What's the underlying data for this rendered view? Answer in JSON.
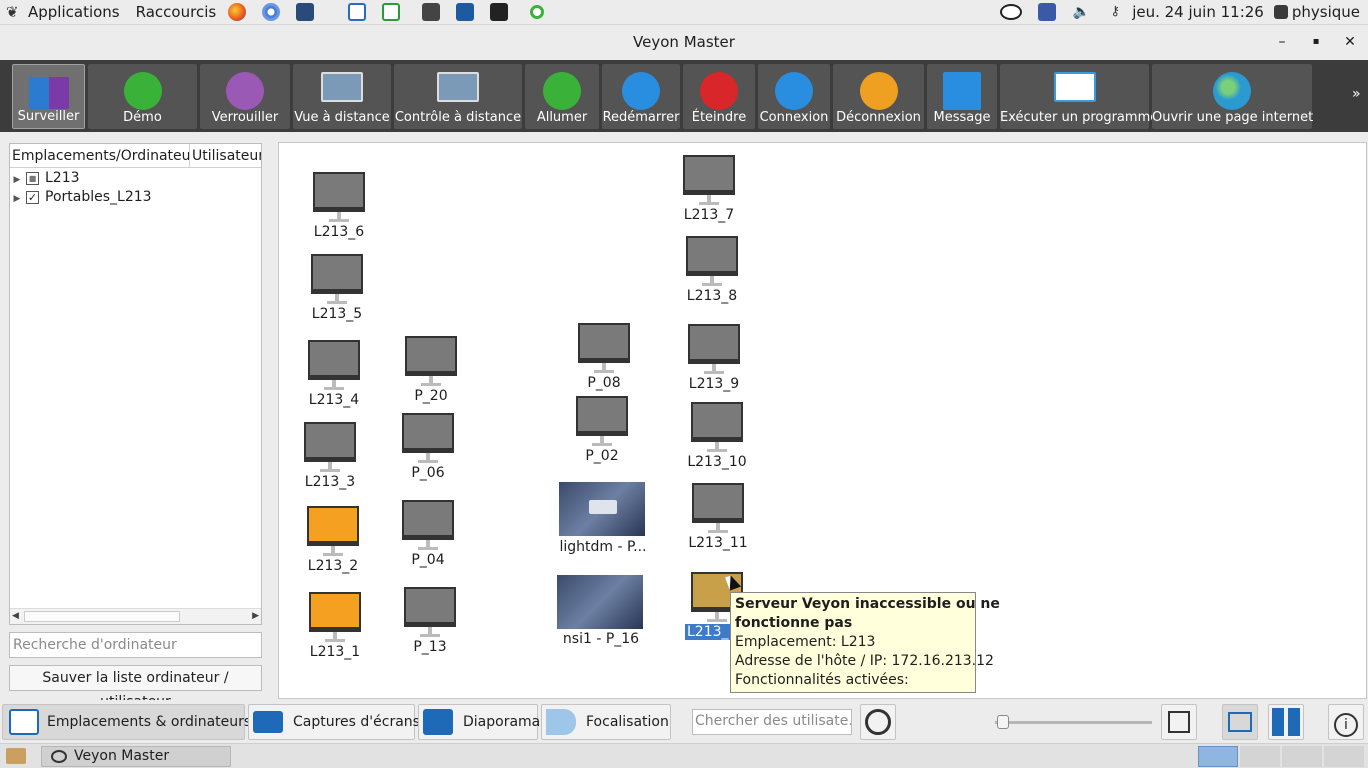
{
  "panel": {
    "applications": "Applications",
    "shortcuts": "Raccourcis",
    "clock": "jeu. 24 juin 11:26",
    "user": "physique",
    "launchers": [
      "firefox-icon",
      "chromium-icon",
      "files-icon",
      "writer-icon",
      "calc-icon",
      "scanner-icon",
      "virtualbox-icon",
      "terminal-icon",
      "sync-icon"
    ]
  },
  "window": {
    "title": "Veyon Master",
    "minimize": "–",
    "maximize": "▪",
    "close": "✕"
  },
  "toolbar": {
    "items": [
      {
        "label": "Surveiller",
        "color": "#3a7ad0"
      },
      {
        "label": "Démo",
        "color": "#3ab23a"
      },
      {
        "label": "Verrouiller",
        "color": "#9b59b6"
      },
      {
        "label": "Vue à distance",
        "color": "#7a9ab8"
      },
      {
        "label": "Contrôle à distance",
        "color": "#7a9ab8"
      },
      {
        "label": "Allumer",
        "color": "#3ab23a"
      },
      {
        "label": "Redémarrer",
        "color": "#2a8ee0"
      },
      {
        "label": "Éteindre",
        "color": "#d9262a"
      },
      {
        "label": "Connexion",
        "color": "#2a8ee0"
      },
      {
        "label": "Déconnexion",
        "color": "#f0a020"
      },
      {
        "label": "Message",
        "color": "#2a8ee0"
      },
      {
        "label": "Exécuter un programme",
        "color": "#3a9ae0"
      },
      {
        "label": "Ouvrir une page internet",
        "color": "#2a9ad0"
      }
    ],
    "more": "»"
  },
  "tree": {
    "col1": "Emplacements/Ordinateur",
    "col2": "Utilisateur",
    "rows": [
      {
        "label": "L213",
        "check": "■"
      },
      {
        "label": "Portables_L213",
        "check": "✓"
      }
    ]
  },
  "search_computer": {
    "placeholder": "Recherche d'ordinateur"
  },
  "save_button": "Sauver la liste ordinateur / utilisateur",
  "computers": {
    "l213_6": "L213_6",
    "l213_5": "L213_5",
    "l213_4": "L213_4",
    "l213_3": "L213_3",
    "l213_2": "L213_2",
    "l213_1": "L213_1",
    "p_20": "P_20",
    "p_06": "P_06",
    "p_04": "P_04",
    "p_13": "P_13",
    "p_08": "P_08",
    "p_02": "P_02",
    "lightdm": "lightdm - P...",
    "nsi1": "nsi1 - P_16",
    "l213_7": "L213_7",
    "l213_8": "L213_8",
    "l213_9": "L213_9",
    "l213_10": "L213_10",
    "l213_11": "L213_11",
    "l213_12": "L213_"
  },
  "tooltip": {
    "title": "Serveur Veyon inaccessible ou ne fonctionne pas",
    "title_line1": "Serveur Veyon inaccessible ou ne",
    "title_line2": "fonctionne pas",
    "location": "Emplacement: L213",
    "address": "Adresse de l'hôte / IP: 172.16.213.12",
    "features": "Fonctionnalités activées:"
  },
  "bottom": {
    "tabs": [
      "Emplacements & ordinateurs",
      "Captures d'écrans",
      "Diaporama",
      "Focalisation"
    ],
    "user_search_placeholder": "Chercher des utilisate...",
    "zoom_level": 0.05
  },
  "taskbar": {
    "item": "Veyon Master"
  }
}
